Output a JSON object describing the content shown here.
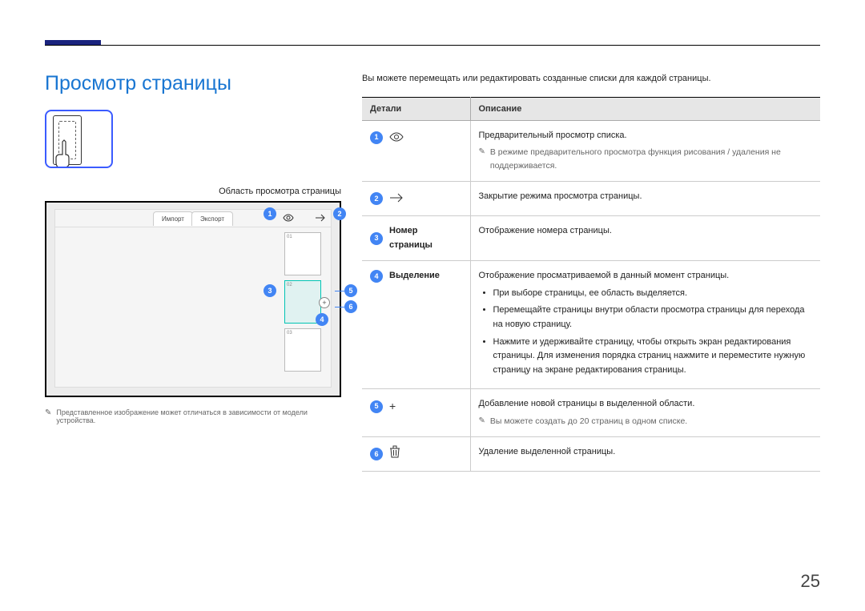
{
  "page_number": "25",
  "heading": "Просмотр страницы",
  "intro": "Вы можете перемещать или редактировать созданные списки для каждой страницы.",
  "left": {
    "caption": "Область просмотра страницы",
    "tabs": {
      "import": "Импорт",
      "export": "Экспорт"
    },
    "thumbs": {
      "n1": "01",
      "n2": "02",
      "n3": "03"
    },
    "disclaimer": "Представленное изображение может отличаться в зависимости от модели устройства."
  },
  "bubbles": {
    "b1": "1",
    "b2": "2",
    "b3": "3",
    "b4": "4",
    "b5": "5",
    "b6": "6"
  },
  "table": {
    "header_details": "Детали",
    "header_desc": "Описание",
    "rows": {
      "r1": {
        "desc_main": "Предварительный просмотр списка.",
        "desc_note": "В режиме предварительного просмотра функция рисования / удаления не поддерживается."
      },
      "r2": {
        "desc_main": "Закрытие режима просмотра страницы."
      },
      "r3": {
        "label": "Номер страницы",
        "desc_main": "Отображение номера страницы."
      },
      "r4": {
        "label": "Выделение",
        "desc_main": "Отображение просматриваемой в данный момент страницы.",
        "li1": "При выборе страницы, ее область выделяется.",
        "li2": "Перемещайте страницы внутри области просмотра страницы для перехода на новую страницу.",
        "li3": "Нажмите и удерживайте страницу, чтобы открыть экран редактирования страницы. Для изменения порядка страниц нажмите и переместите нужную страницу на экране редактирования страницы."
      },
      "r5": {
        "desc_main": "Добавление новой страницы в выделенной области.",
        "desc_note": "Вы можете создать до 20 страниц в одном списке."
      },
      "r6": {
        "desc_main": "Удаление выделенной страницы."
      }
    }
  }
}
